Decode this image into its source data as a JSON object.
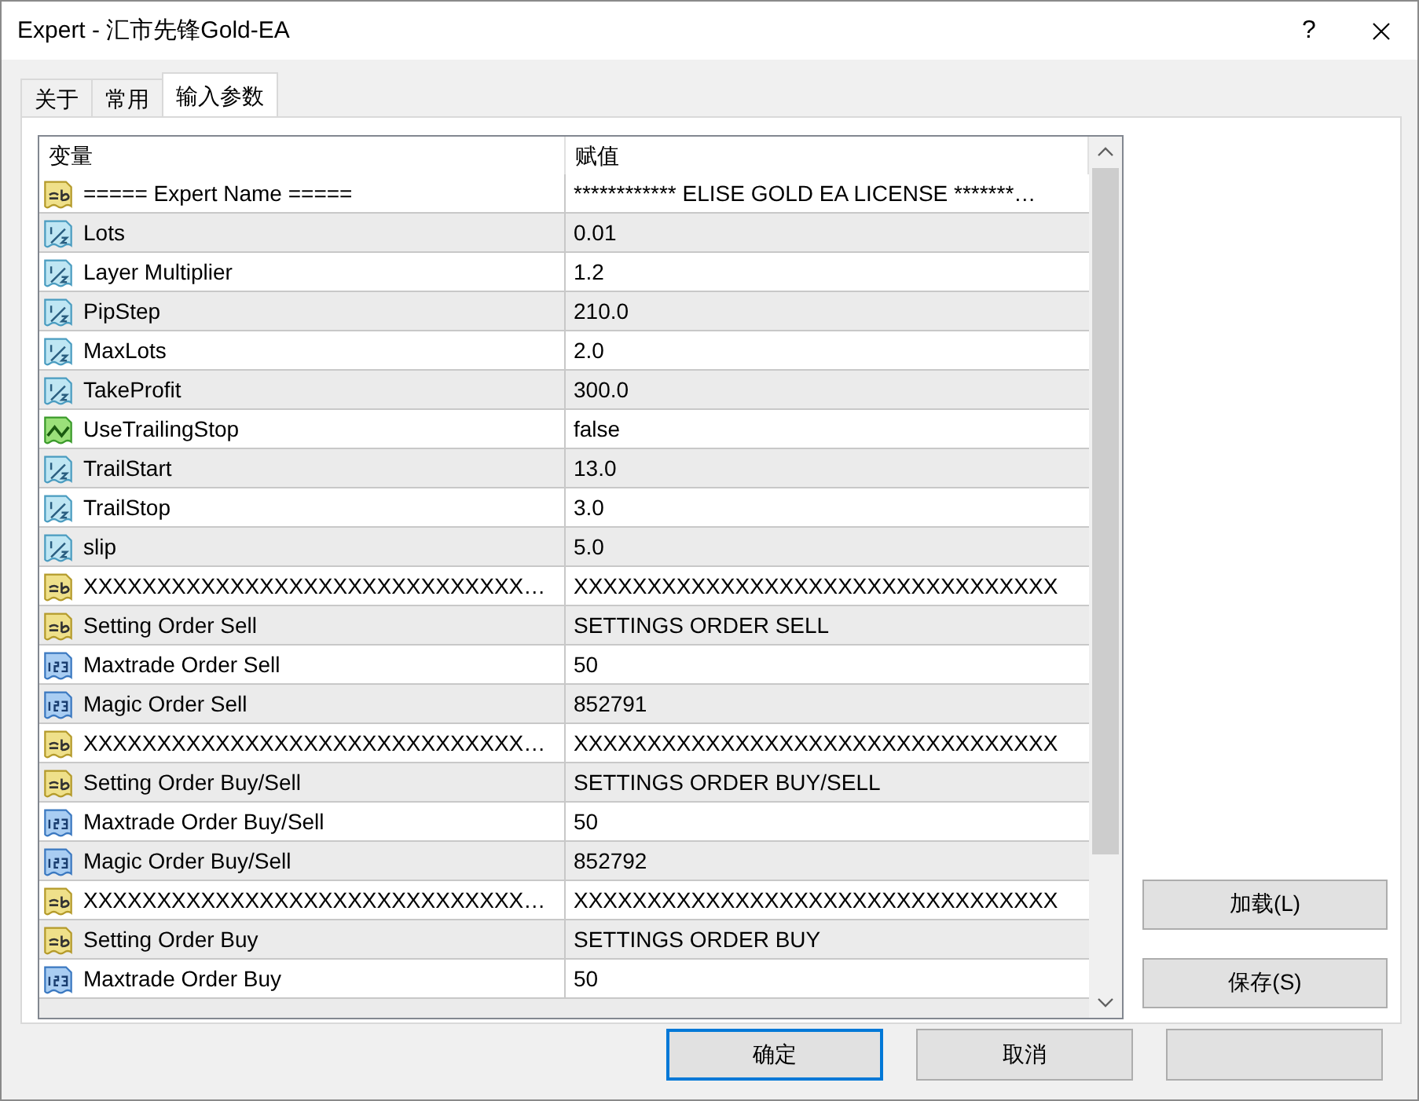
{
  "window": {
    "title": "Expert - 汇市先锋Gold-EA",
    "help": "?"
  },
  "tabs": [
    {
      "label": "关于",
      "selected": false
    },
    {
      "label": "常用",
      "selected": false
    },
    {
      "label": "输入参数",
      "selected": true
    }
  ],
  "table": {
    "columns": [
      "变量",
      "赋值"
    ],
    "rows": [
      {
        "kind": "string",
        "name": "===== Expert Name =====",
        "value": "************ ELISE GOLD EA LICENSE *******…"
      },
      {
        "kind": "double",
        "name": "Lots",
        "value": "0.01"
      },
      {
        "kind": "double",
        "name": "Layer Multiplier",
        "value": "1.2"
      },
      {
        "kind": "double",
        "name": "PipStep",
        "value": "210.0"
      },
      {
        "kind": "double",
        "name": "MaxLots",
        "value": "2.0"
      },
      {
        "kind": "double",
        "name": "TakeProfit",
        "value": "300.0"
      },
      {
        "kind": "bool",
        "name": "UseTrailingStop",
        "value": "false"
      },
      {
        "kind": "double",
        "name": "TrailStart",
        "value": "13.0"
      },
      {
        "kind": "double",
        "name": "TrailStop",
        "value": "3.0"
      },
      {
        "kind": "double",
        "name": "slip",
        "value": "5.0"
      },
      {
        "kind": "string",
        "name": "XXXXXXXXXXXXXXXXXXXXXXXXXXXXXX…",
        "value": "XXXXXXXXXXXXXXXXXXXXXXXXXXXXXXXXX"
      },
      {
        "kind": "string",
        "name": "Setting Order Sell",
        "value": "SETTINGS ORDER SELL"
      },
      {
        "kind": "int",
        "name": "Maxtrade Order Sell",
        "value": "50"
      },
      {
        "kind": "int",
        "name": "Magic Order Sell",
        "value": "852791"
      },
      {
        "kind": "string",
        "name": "XXXXXXXXXXXXXXXXXXXXXXXXXXXXXX…",
        "value": "XXXXXXXXXXXXXXXXXXXXXXXXXXXXXXXXX"
      },
      {
        "kind": "string",
        "name": "Setting Order Buy/Sell",
        "value": "SETTINGS ORDER BUY/SELL"
      },
      {
        "kind": "int",
        "name": "Maxtrade Order Buy/Sell",
        "value": "50"
      },
      {
        "kind": "int",
        "name": "Magic Order Buy/Sell",
        "value": "852792"
      },
      {
        "kind": "string",
        "name": "XXXXXXXXXXXXXXXXXXXXXXXXXXXXXX…",
        "value": "XXXXXXXXXXXXXXXXXXXXXXXXXXXXXXXXX"
      },
      {
        "kind": "string",
        "name": "Setting Order Buy",
        "value": "SETTINGS ORDER BUY"
      },
      {
        "kind": "int",
        "name": "Maxtrade Order Buy",
        "value": "50"
      }
    ]
  },
  "side_buttons": [
    "加载(L)",
    "保存(S)"
  ],
  "footer_buttons": [
    {
      "label": "确定",
      "default": true
    },
    {
      "label": "取消",
      "default": false
    },
    {
      "default": false
    }
  ]
}
